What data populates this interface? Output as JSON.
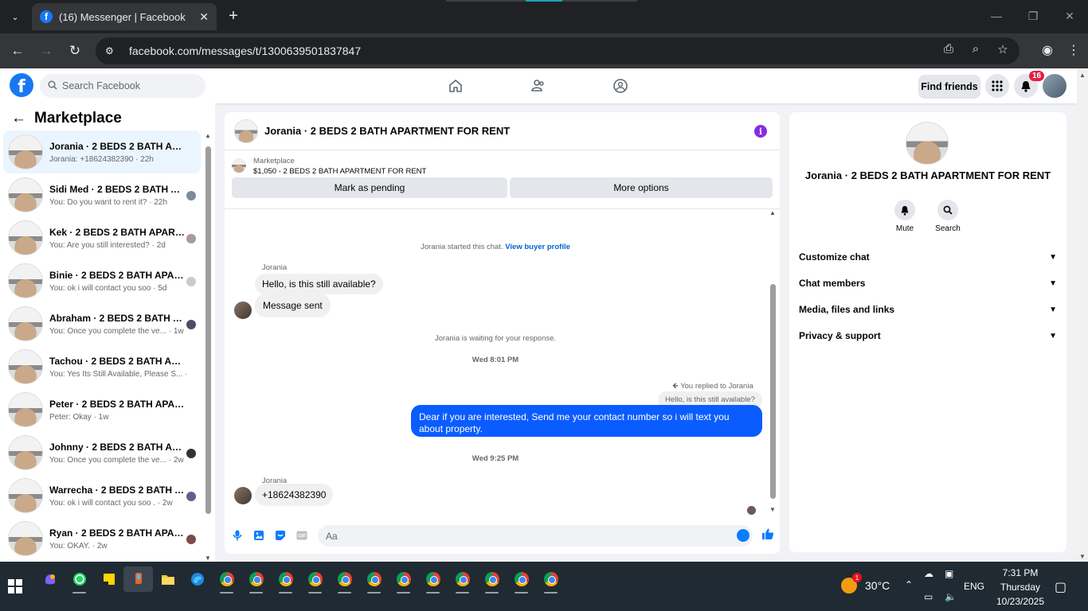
{
  "browser": {
    "tab_title": "(16) Messenger | Facebook",
    "url": "facebook.com/messages/t/1300639501837847"
  },
  "fb": {
    "search_placeholder": "Search Facebook",
    "find_friends": "Find friends",
    "notif_count": "16"
  },
  "left": {
    "title": "Marketplace",
    "conversations": [
      {
        "name": "Jorania · 2 BEDS 2 BATH APART...",
        "preview": "Jorania: +18624382390 · 22h"
      },
      {
        "name": "Sidi Med · 2 BEDS 2 BATH AP...",
        "preview": "You: Do you want to rent it? · 22h"
      },
      {
        "name": "Kek · 2 BEDS 2 BATH APART...",
        "preview": "You: Are you still interested? · 2d"
      },
      {
        "name": "Binie · 2 BEDS 2 BATH APART...",
        "preview": "You: ok i will contact you soo · 5d"
      },
      {
        "name": "Abraham · 2 BEDS 2 BATH AP...",
        "preview": "You: Once you complete the ve... · 1w"
      },
      {
        "name": "Tachou · 2 BEDS 2 BATH APART...",
        "preview": "You: Yes Its Still Available, Please S... · 1w"
      },
      {
        "name": "Peter · 2 BEDS 2 BATH APARTM...",
        "preview": "Peter: Okay · 1w"
      },
      {
        "name": "Johnny · 2 BEDS 2 BATH APA...",
        "preview": "You: Once you complete the ve... · 2w"
      },
      {
        "name": "Warrecha · 2 BEDS 2 BATH A...",
        "preview": "You: ok i will contact you soo . · 2w"
      },
      {
        "name": "Ryan · 2 BEDS 2 BATH APART...",
        "preview": "You: OKAY. · 2w"
      }
    ]
  },
  "chat": {
    "title": "Jorania · 2 BEDS 2 BATH APARTMENT FOR RENT",
    "marketplace_label": "Marketplace",
    "listing": "$1,050 - 2 BEDS 2 BATH APARTMENT FOR RENT",
    "mark_pending": "Mark as pending",
    "more_options": "More options",
    "started_text": "Jorania started this chat.",
    "view_buyer": "View buyer profile",
    "sender_name": "Jorania",
    "msg1": "Hello, is this still available?",
    "msg2": "Message sent",
    "waiting": "Jorania is waiting for your response.",
    "ts1": "Wed 8:01 PM",
    "replied_to": "You replied to Jorania",
    "quoted": "Hello, is this still available?",
    "outgoing": "Dear if you are interested, Send me your contact number so i will text you about property.",
    "ts2": "Wed 9:25 PM",
    "msg3": "+18624382390",
    "composer_placeholder": "Aa"
  },
  "right": {
    "name": "Jorania · 2 BEDS 2 BATH APARTMENT FOR RENT",
    "mute": "Mute",
    "search": "Search",
    "sections": [
      "Customize chat",
      "Chat members",
      "Media, files and links",
      "Privacy & support"
    ]
  },
  "taskbar": {
    "temp": "30°C",
    "lang": "ENG",
    "time": "7:31 PM",
    "day": "Thursday",
    "date": "10/23/2025"
  }
}
